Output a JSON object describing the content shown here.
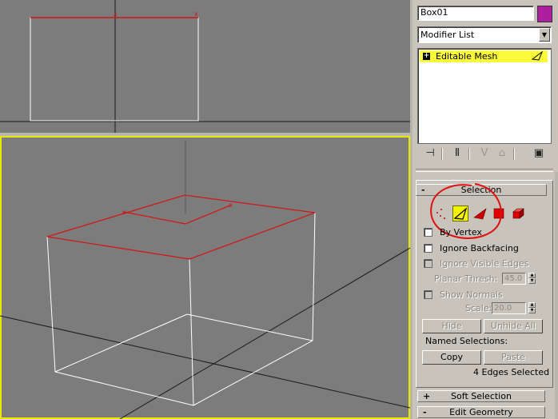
{
  "object": {
    "name": "Box01",
    "color": "#b01ea0"
  },
  "modifier_list": {
    "label": "Modifier List"
  },
  "modifier_stack": {
    "items": [
      {
        "label": "Editable Mesh"
      }
    ]
  },
  "selection": {
    "title": "Selection",
    "active_level": "edge",
    "by_vertex": "By Vertex",
    "ignore_backfacing": "Ignore Backfacing",
    "ignore_visible_edges": "Ignore Visible Edges",
    "planar_thresh_label": "Planar Thresh:",
    "planar_thresh_value": "45.0",
    "show_normals": "Show Normals",
    "scale_label": "Scale:",
    "scale_value": "20.0",
    "hide": "Hide",
    "unhide_all": "Unhide All",
    "named_selections": "Named Selections:",
    "copy": "Copy",
    "paste": "Paste",
    "status": "4 Edges Selected"
  },
  "rollouts": {
    "soft_selection": {
      "sign": "+",
      "title": "Soft Selection"
    },
    "edit_geometry": {
      "sign": "-",
      "title": "Edit Geometry"
    }
  },
  "colors": {
    "viewport_bg": "#7c7c7c",
    "active_border": "#e8e800",
    "selected_edge": "#d01818",
    "wire": "#ffffff",
    "highlight": "#f4f400"
  }
}
